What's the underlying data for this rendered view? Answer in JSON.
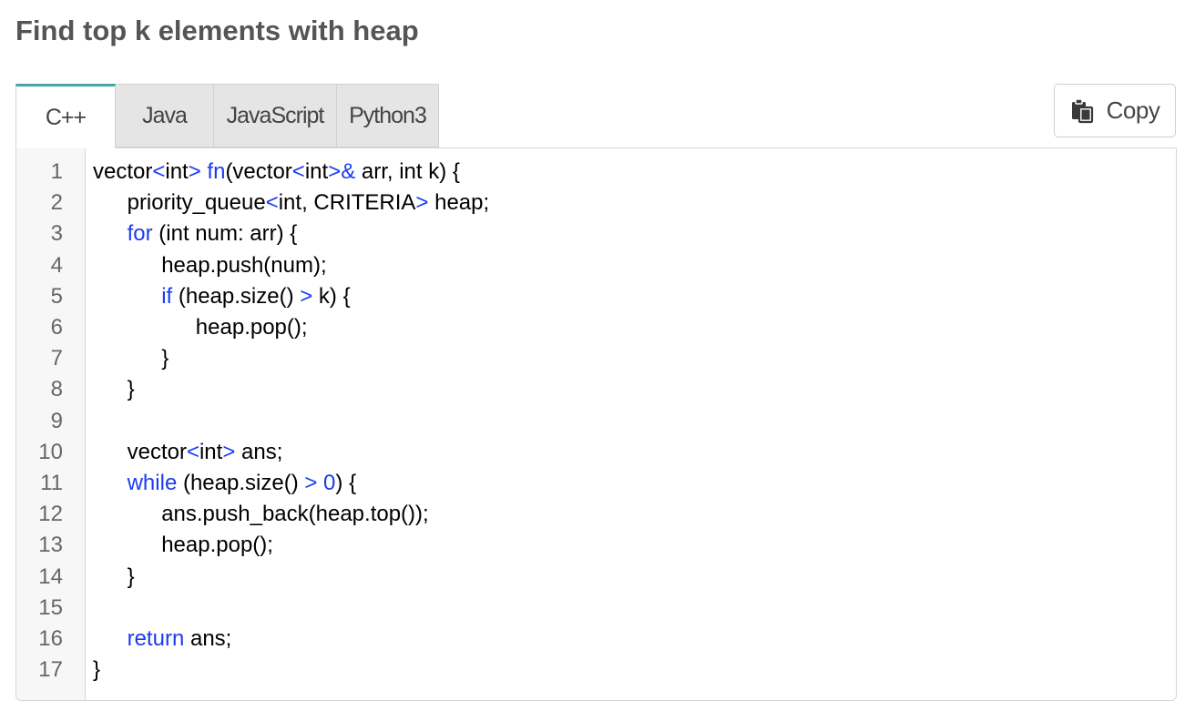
{
  "page": {
    "title": "Find top k elements with heap"
  },
  "tabs": [
    {
      "label": "C++",
      "active": true
    },
    {
      "label": "Java",
      "active": false
    },
    {
      "label": "JavaScript",
      "active": false
    },
    {
      "label": "Python3",
      "active": false
    }
  ],
  "copy": {
    "label": "Copy",
    "icon": "clipboard-icon"
  },
  "colors": {
    "accent": "#43a5a5",
    "keyword": "#1a3cf0",
    "title": "#555555"
  },
  "code": {
    "language": "C++",
    "line_numbers": [
      "1",
      "2",
      "3",
      "4",
      "5",
      "6",
      "7",
      "8",
      "9",
      "10",
      "11",
      "12",
      "13",
      "14",
      "15",
      "16",
      "17"
    ],
    "lines": [
      "vector<int> fn(vector<int>& arr, int k) {",
      "    priority_queue<int, CRITERIA> heap;",
      "    for (int num: arr) {",
      "        heap.push(num);",
      "        if (heap.size() > k) {",
      "            heap.pop();",
      "        }",
      "    }",
      "",
      "    vector<int> ans;",
      "    while (heap.size() > 0) {",
      "        ans.push_back(heap.top());",
      "        heap.pop();",
      "    }",
      "",
      "    return ans;",
      "}"
    ]
  }
}
